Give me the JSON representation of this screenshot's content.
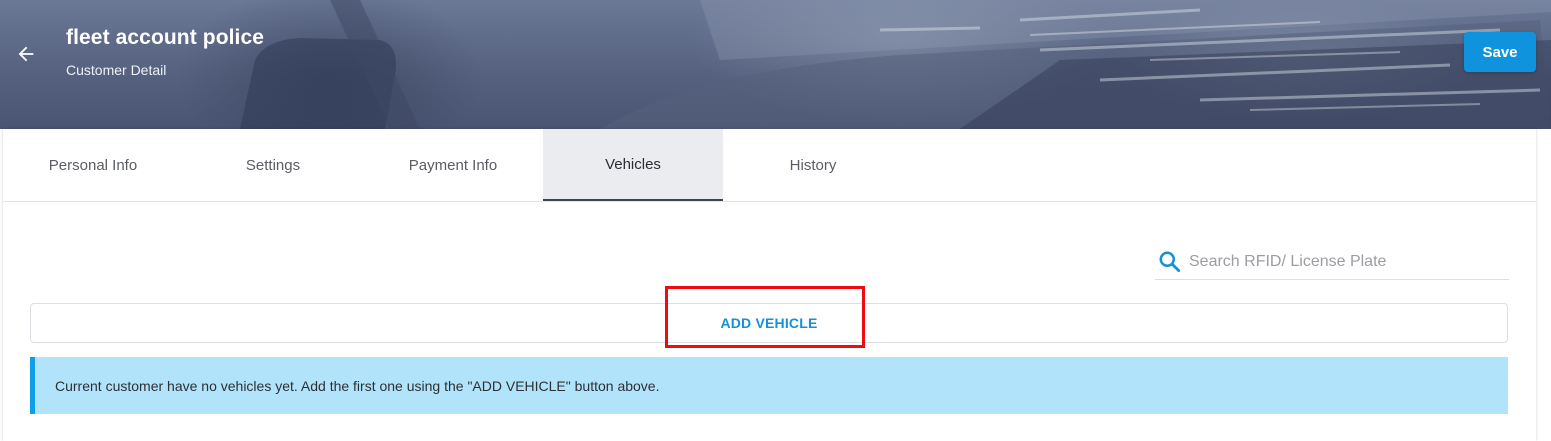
{
  "header": {
    "title": "fleet account police",
    "subtitle": "Customer Detail",
    "back_icon": "arrow-left-icon",
    "save_label": "Save",
    "save_color": "#0f93dc"
  },
  "tabs": [
    {
      "label": "Personal Info",
      "active": false
    },
    {
      "label": "Settings",
      "active": false
    },
    {
      "label": "Payment Info",
      "active": false
    },
    {
      "label": "Vehicles",
      "active": true
    },
    {
      "label": "History",
      "active": false
    }
  ],
  "search": {
    "icon": "search-icon",
    "placeholder": "Search RFID/ License Plate",
    "value": ""
  },
  "add_vehicle": {
    "label": "ADD VEHICLE",
    "highlight_color": "#ef0b12"
  },
  "notice": {
    "text": "Current customer have no vehicles yet. Add the first one using the \"ADD VEHICLE\" button above.",
    "background": "#b1e3fa",
    "accent": "#0f9fe8"
  }
}
